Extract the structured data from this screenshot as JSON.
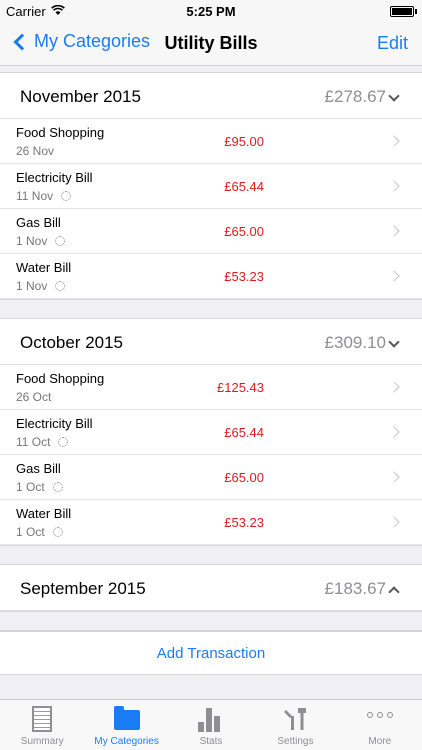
{
  "status": {
    "carrier": "Carrier",
    "time": "5:25 PM"
  },
  "nav": {
    "back_label": "My Categories",
    "title": "Utility Bills",
    "edit_label": "Edit"
  },
  "months": [
    {
      "name": "November 2015",
      "total": "£278.67",
      "expanded": true,
      "transactions": [
        {
          "name": "Food Shopping",
          "date": "26 Nov",
          "amount": "£95.00",
          "recurring": false
        },
        {
          "name": "Electricity Bill",
          "date": "11 Nov",
          "amount": "£65.44",
          "recurring": true
        },
        {
          "name": "Gas Bill",
          "date": "1 Nov",
          "amount": "£65.00",
          "recurring": true
        },
        {
          "name": "Water Bill",
          "date": "1 Nov",
          "amount": "£53.23",
          "recurring": true
        }
      ]
    },
    {
      "name": "October 2015",
      "total": "£309.10",
      "expanded": true,
      "transactions": [
        {
          "name": "Food Shopping",
          "date": "26 Oct",
          "amount": "£125.43",
          "recurring": false
        },
        {
          "name": "Electricity Bill",
          "date": "11 Oct",
          "amount": "£65.44",
          "recurring": true
        },
        {
          "name": "Gas Bill",
          "date": "1 Oct",
          "amount": "£65.00",
          "recurring": true
        },
        {
          "name": "Water Bill",
          "date": "1 Oct",
          "amount": "£53.23",
          "recurring": true
        }
      ]
    },
    {
      "name": "September 2015",
      "total": "£183.67",
      "expanded": false,
      "transactions": []
    }
  ],
  "add_transaction_label": "Add Transaction",
  "tabs": [
    {
      "label": "Summary",
      "icon": "summary-icon",
      "active": false
    },
    {
      "label": "My Categories",
      "icon": "folder-icon",
      "active": true
    },
    {
      "label": "Stats",
      "icon": "stats-icon",
      "active": false
    },
    {
      "label": "Settings",
      "icon": "tools-icon",
      "active": false
    },
    {
      "label": "More",
      "icon": "more-icon",
      "active": false
    }
  ],
  "colors": {
    "accent": "#1a7cf5",
    "amount": "#e0191f",
    "muted": "#8e8e93"
  }
}
